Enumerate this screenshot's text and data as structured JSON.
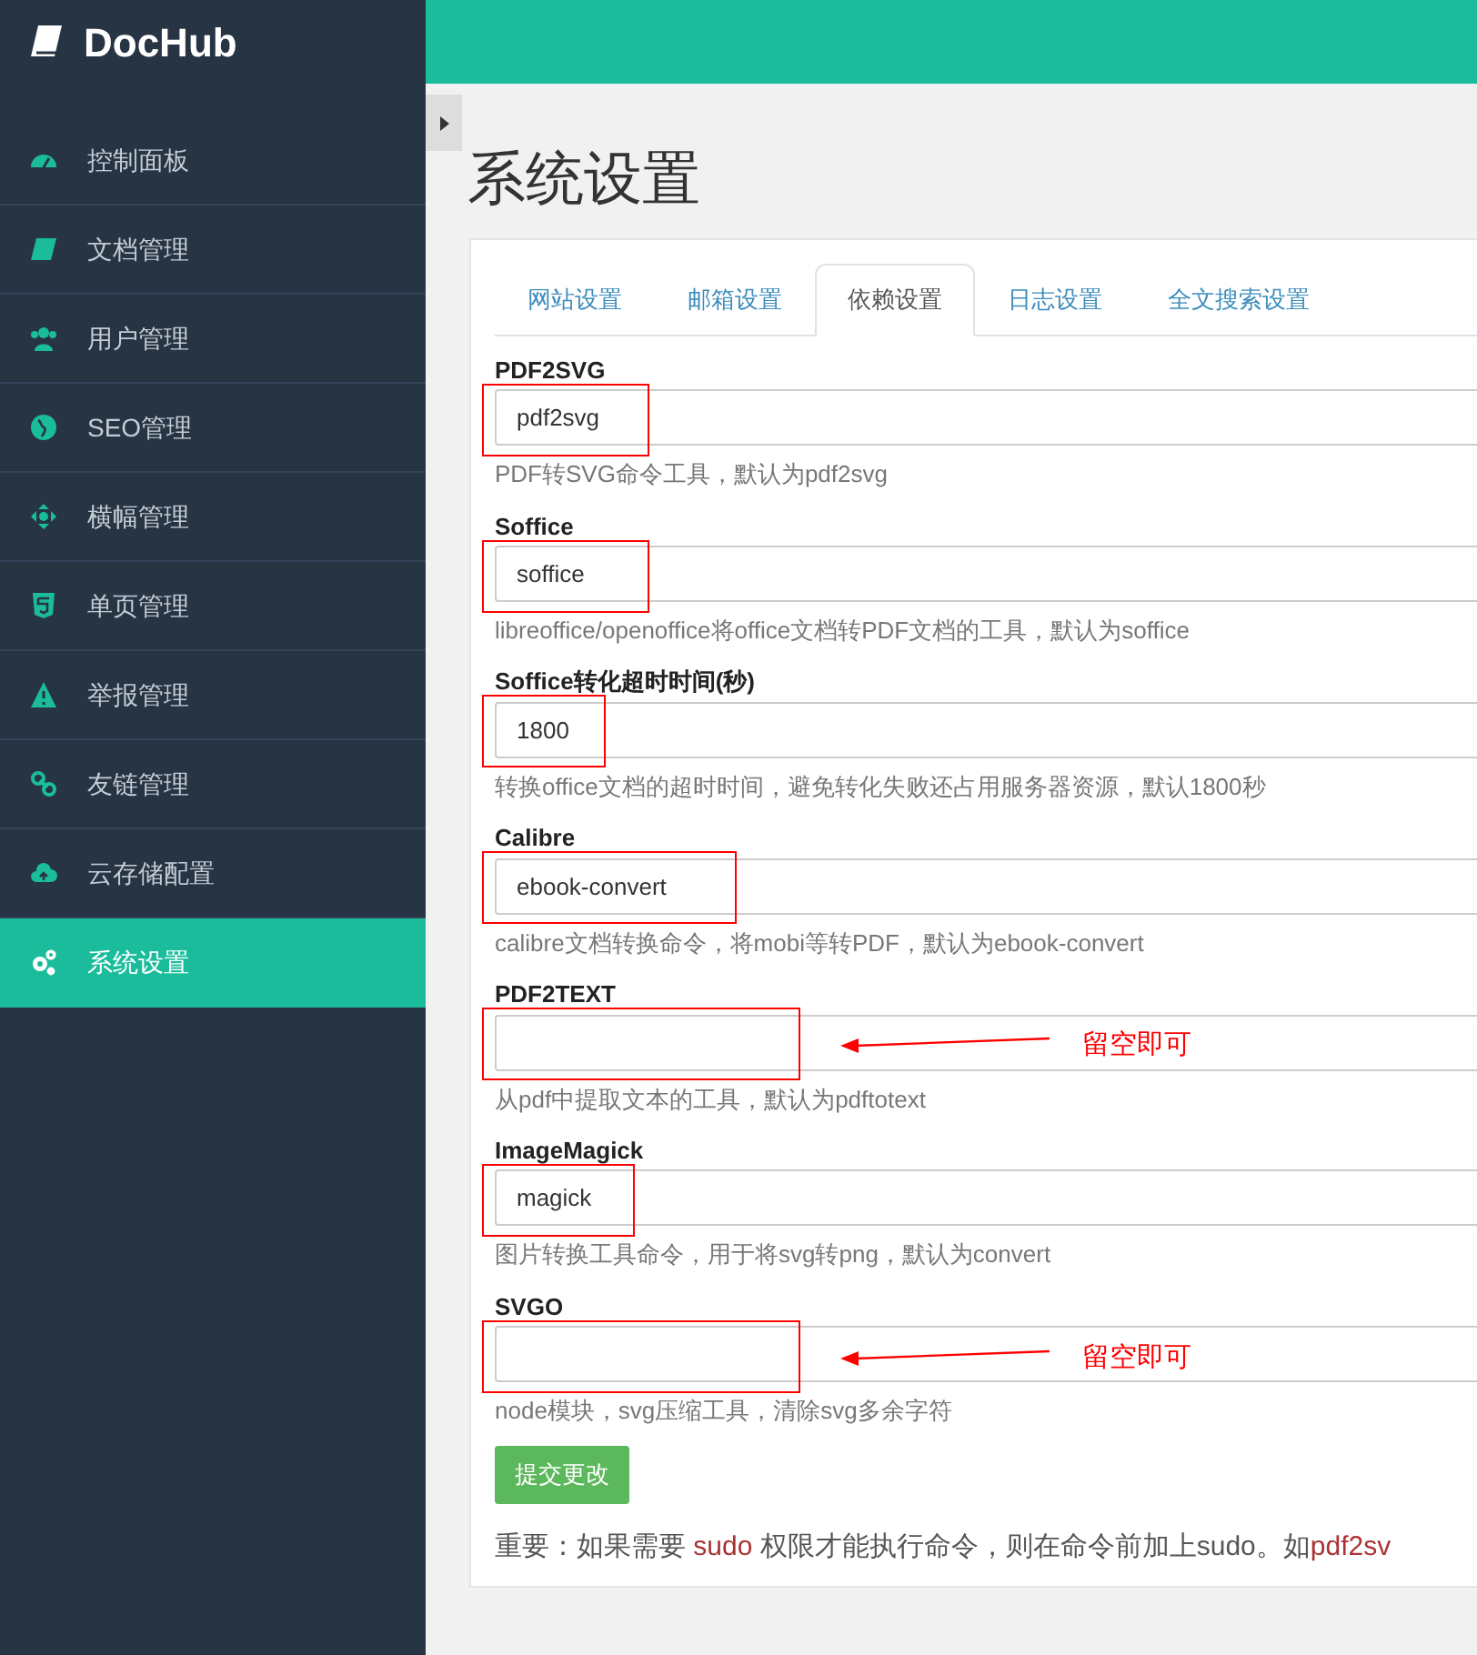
{
  "brand": {
    "name": "DocHub"
  },
  "sidebar": {
    "items": [
      {
        "label": "控制面板",
        "selected": false
      },
      {
        "label": "文档管理",
        "selected": false
      },
      {
        "label": "用户管理",
        "selected": false
      },
      {
        "label": "SEO管理",
        "selected": false
      },
      {
        "label": "横幅管理",
        "selected": false
      },
      {
        "label": "单页管理",
        "selected": false
      },
      {
        "label": "举报管理",
        "selected": false
      },
      {
        "label": "友链管理",
        "selected": false
      },
      {
        "label": "云存储配置",
        "selected": false
      },
      {
        "label": "系统设置",
        "selected": true
      }
    ]
  },
  "page_title": "系统设置",
  "tabs": [
    {
      "label": "网站设置",
      "selected": false
    },
    {
      "label": "邮箱设置",
      "selected": false
    },
    {
      "label": "依赖设置",
      "selected": true
    },
    {
      "label": "日志设置",
      "selected": false
    },
    {
      "label": "全文搜索设置",
      "selected": false
    }
  ],
  "fields": [
    {
      "label": "PDF2SVG",
      "value": "pdf2svg",
      "help": "PDF转SVG命令工具，默认为pdf2svg",
      "highlighted": true
    },
    {
      "label": "Soffice",
      "value": "soffice",
      "help": "libreoffice/openoffice将office文档转PDF文档的工具，默认为soffice",
      "highlighted": true
    },
    {
      "label": "Soffice转化超时时间(秒)",
      "value": "1800",
      "help": "转换office文档的超时时间，避免转化失败还占用服务器资源，默认1800秒",
      "highlighted": true
    },
    {
      "label": "Calibre",
      "value": "ebook-convert",
      "help": "calibre文档转换命令，将mobi等转PDF，默认为ebook-convert",
      "highlighted": true
    },
    {
      "label": "PDF2TEXT",
      "help": "从pdf中提取文本的工具，默认为pdftotext",
      "highlighted": true,
      "note": "留空即可"
    },
    {
      "label": "ImageMagick",
      "value": "magick",
      "help": "图片转换工具命令，用于将svg转png，默认为convert",
      "highlighted": true
    },
    {
      "label": "SVGO",
      "help": "node模块，svg压缩工具，清除svg多余字符",
      "highlighted": true,
      "note": "留空即可"
    }
  ],
  "submit_button": "提交更改",
  "notice": [
    {
      "kind": "text",
      "text": "重要：如果需要 "
    },
    {
      "kind": "code",
      "text": "sudo"
    },
    {
      "kind": "text",
      "text": " 权限才能执行命令，则在命令前加上sudo。如"
    },
    {
      "kind": "code",
      "text": "pdf2sv"
    }
  ]
}
